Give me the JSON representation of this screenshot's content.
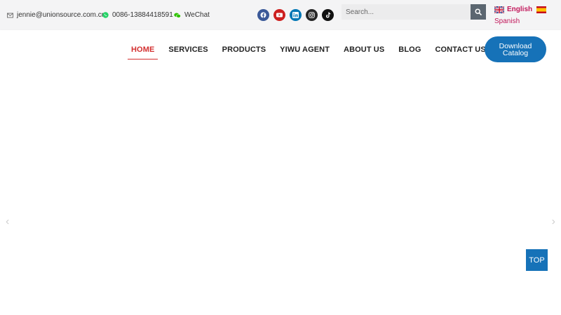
{
  "topbar": {
    "email": "jennie@unionsource.com.cn",
    "phone": "0086-13884418591",
    "wechat": "WeChat",
    "social_icons": [
      "facebook-icon",
      "youtube-icon",
      "linkedin-icon",
      "instagram-icon",
      "tiktok-icon"
    ],
    "social_colors": [
      "#3b5998",
      "#cd201f",
      "#0077b5",
      "#262626",
      "#111111"
    ],
    "search_placeholder": "Search...",
    "languages": {
      "current": "English",
      "other": "Spanish"
    }
  },
  "nav": {
    "items": [
      "HOME",
      "SERVICES",
      "PRODUCTS",
      "YIWU AGENT",
      "ABOUT US",
      "BLOG",
      "CONTACT US"
    ],
    "active": "HOME",
    "catalog_button": "Download Catalog"
  },
  "slider": {
    "prev": "‹",
    "next": "›"
  },
  "back_to_top": "TOP",
  "colors": {
    "accent_blue": "#1672b8",
    "active_red": "#d32f2f",
    "language_pink": "#c2185b"
  }
}
